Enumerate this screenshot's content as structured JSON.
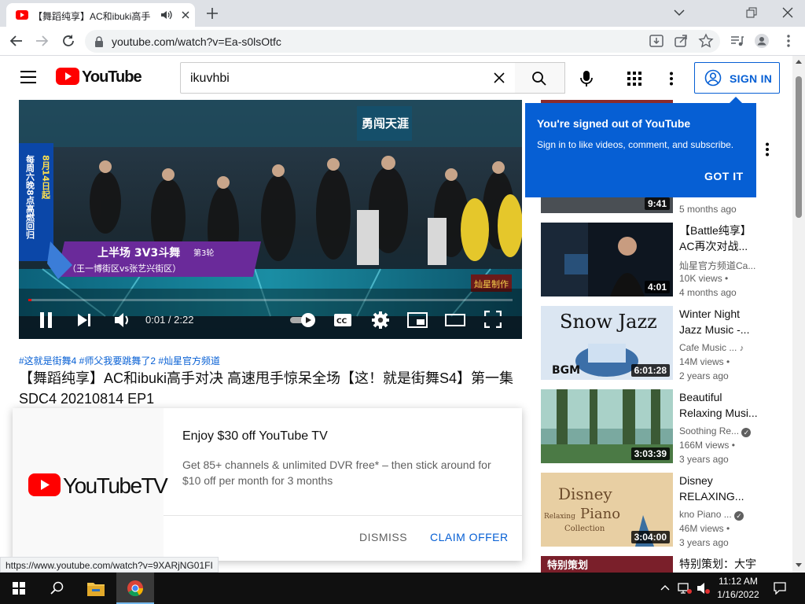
{
  "browser": {
    "tab_title": "【舞蹈纯享】AC和ibuki高手对",
    "url": "youtube.com/watch?v=Ea-s0lsOtfc",
    "status_url": "https://www.youtube.com/watch?v=9XARjNG01FI"
  },
  "masthead": {
    "logo_text": "YouTube",
    "search_value": "ikuvhbi",
    "signin_label": "SIGN IN"
  },
  "player": {
    "time_text": "0:01 / 2:22",
    "progress_fraction": 0.007,
    "overlay": {
      "show_logo": "勇闯天涯",
      "side_banner": "每周六晚8点高燃回归",
      "side_date": "8月14日起",
      "segment_title": "上半场  3V3斗舞",
      "segment_round": "第3轮",
      "segment_teams": "（王一博街区vs张艺兴街区）",
      "watermark": "灿星制作"
    }
  },
  "video": {
    "hashtags": "#这就是街舞4 #师父我要跳舞了2 #灿星官方频道",
    "title": "【舞蹈纯享】AC和ibuki高手对决 高速甩手惊呆全场【这！就是街舞S4】第一集 SDC4 20210814 EP1"
  },
  "promo": {
    "logo_text": "YouTubeTV",
    "heading": "Enjoy $30 off YouTube TV",
    "body": "Get 85+ channels & unlimited DVR free* – then stick around for $10 off per month for 3 months",
    "dismiss_label": "DISMISS",
    "claim_label": "CLAIM OFFER"
  },
  "tooltip": {
    "title": "You're signed out of YouTube",
    "body": "Sign in to like videos, comment, and subscribe.",
    "button": "GOT IT"
  },
  "recommendations": [
    {
      "title": "",
      "channel": "",
      "views": "",
      "age": "5 months ago",
      "duration": "9:41"
    },
    {
      "title": "【Battle纯享】AC再次对战...",
      "channel": "灿星官方频道Ca...",
      "views": "10K views •",
      "age": "4 months ago",
      "duration": "4:01"
    },
    {
      "title": "Winter Night Jazz Music -...",
      "channel": "Cafe Music ...",
      "views": "14M views •",
      "age": "2 years ago",
      "duration": "6:01:28",
      "thumb_text": "Snow Jazz",
      "thumb_sub": "BGM"
    },
    {
      "title": "Beautiful Relaxing Musi...",
      "channel": "Soothing Re...",
      "views": "166M views •",
      "age": "3 years ago",
      "duration": "3:03:39"
    },
    {
      "title": "Disney RELAXING...",
      "channel": "kno Piano ...",
      "views": "46M views •",
      "age": "3 years ago",
      "duration": "3:04:00",
      "thumb_text": "Disney",
      "thumb_sub": "Piano",
      "thumb_side": "Relaxing",
      "thumb_foot": "Collection"
    },
    {
      "title": "特别策划：大宇",
      "channel": "",
      "views": "",
      "age": "",
      "duration": "",
      "thumb_text": "特别策划"
    }
  ],
  "taskbar": {
    "time": "11:12 AM",
    "date": "1/16/2022"
  },
  "colors": {
    "youtube_red": "#ff0000",
    "link_blue": "#065fd4",
    "tooltip_blue": "#065fd4",
    "taskbar": "#101010"
  },
  "icons": [
    "back-icon",
    "forward-icon",
    "reload-icon",
    "lock-icon",
    "install-icon",
    "share-icon",
    "star-icon",
    "media-icon",
    "profile-icon",
    "kebab-icon",
    "hamburger-icon",
    "search-icon",
    "clear-icon",
    "mic-icon",
    "apps-icon",
    "user-circle-icon",
    "play-pause-icon",
    "next-icon",
    "volume-icon",
    "autoplay-icon",
    "cc-icon",
    "settings-icon",
    "miniplayer-icon",
    "theater-icon",
    "fullscreen-icon",
    "windows-start-icon",
    "taskbar-search-icon",
    "file-explorer-icon",
    "chrome-icon"
  ]
}
